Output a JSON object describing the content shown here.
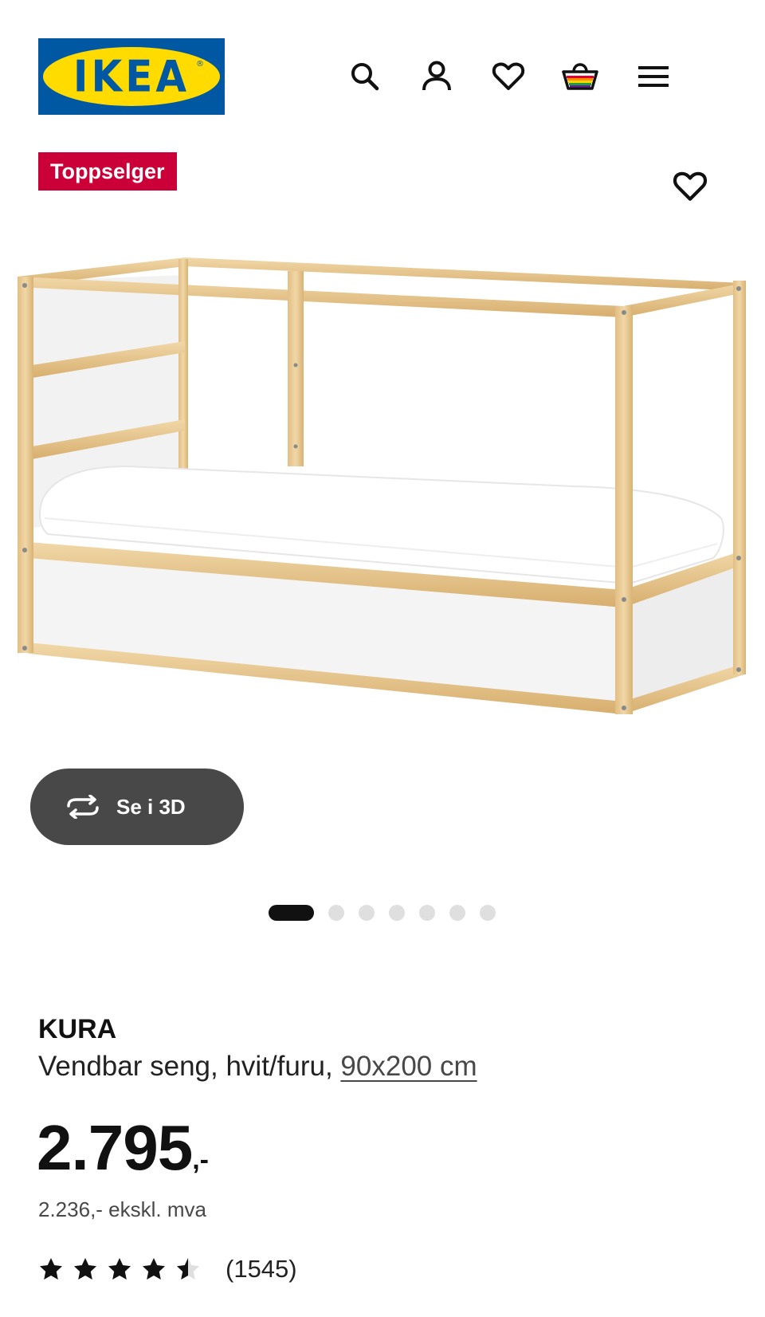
{
  "header": {
    "logo_text": "IKEA",
    "logo_reg": "®",
    "icons": [
      "search-icon",
      "user-icon",
      "heart-icon",
      "shopping-basket-icon",
      "hamburger-menu-icon"
    ]
  },
  "badge": {
    "label": "Toppselger",
    "color": "#CC0038"
  },
  "viewer": {
    "button_label": "Se i 3D"
  },
  "carousel": {
    "total_images": 7,
    "active_index": 1
  },
  "product": {
    "name": "KURA",
    "description": "Vendbar seng, hvit/furu,",
    "size_link": "90x200 cm",
    "price_main": "2.795",
    "price_suffix": ",-",
    "price_excl_vat": "2.236,- ekskl. mva",
    "rating_stars": 4.5,
    "rating_count": "(1545)"
  },
  "colors": {
    "ikea_blue": "#0058A3",
    "ikea_yellow": "#FFDB00",
    "badge_red": "#CC0038",
    "button_dark": "#484848"
  }
}
